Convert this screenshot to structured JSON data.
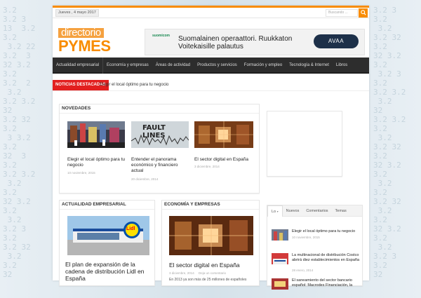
{
  "background": {
    "left_digits": "3.2\n3.2 3\n13  3.2\n3.2\n 3.2 22\n3.2  3\n32 3.2\n3.2\n3.2  2\n 3.2\n3.2 3.2\n32\n3.2 32\n3.2\n 3 3.2\n3.2\n32  3\n3.2\n3.2 3.2\n 3.2\n3.2\n32 3.2\n3.2\n 3.2\n3.2 3\n3.2\n3.2 32\n 3.2\n3.2\n32",
    "right_digits": "3.2 3\n3.2\n 3.2\n3.2 32\n3.2\n32 3.2\n3.2\n 3.2 3\n3.2\n3.2 3.2\n 3.2\n32\n3.2 3.2\n3.2\n 3.2\n3.2 32\n3.2\n32 3.2\n3.2\n 3.2\n3.2\n3.2 32\n 3.2\n3.2\n32 3.2\n3.2\n 3.2\n3.2 3\n3.2\n32"
  },
  "topbar": {
    "date": "Jueves , 4 mayo 2017",
    "search_placeholder": "Buscando ..."
  },
  "logo": {
    "line1": "directorio",
    "line2": "PYMES"
  },
  "ad": {
    "brand": "suomicom",
    "text": "Suomalainen operaattori. Ruukkaton Voitekaisille palautus",
    "button": "AVAA"
  },
  "nav": {
    "items": [
      "Actualidad empresarial",
      "Economía y empresas",
      "Áreas de actividad",
      "Productos y servicios",
      "Formación y empleo",
      "Tecnología & Internet",
      "Libros"
    ]
  },
  "ticker": {
    "label": "NOTICIAS DESTACADAS",
    "text": "Elegir el local óptimo para tu negocio"
  },
  "novedades": {
    "title": "NOVEDADES",
    "posts": [
      {
        "title": "Elegir el local óptimo para tu negocio",
        "date": "10 noviembre, 2015"
      },
      {
        "title": "Entender el panorama económico y financiero actual",
        "date": "20 diciembre, 2014",
        "thumb_text": "FAULT\nLINES"
      },
      {
        "title": "El sector digital en España",
        "date": "3 diciembre, 2014"
      }
    ]
  },
  "actualidad": {
    "title": "ACTUALIDAD EMPRESARIAL",
    "post_title": "El plan de expansión de la cadena de distribución Lidl en España",
    "thumb_sign": "Lidl"
  },
  "economia": {
    "title": "ECONOMÍA Y EMPRESAS",
    "post_title": "El sector digital en España",
    "post_date": "3 diciembre, 2014",
    "post_comments": "Deja un comentario",
    "excerpt": "En 2013 ya son más de 25 millones de españoles"
  },
  "sidebar": {
    "tabs": [
      "Lo",
      "Nuevos",
      "Comentarios",
      "Temas"
    ],
    "items": [
      {
        "title": "Elegir el local óptimo para tu negocio",
        "date": "10 noviembre, 2015"
      },
      {
        "title": "La multinacional de distribución Costco abrirá diez establecimientos en España",
        "date": "28 enero, 2014"
      },
      {
        "title": "El saneamiento del sector bancario español: Macrodes Financiación, la",
        "date": ""
      }
    ]
  },
  "colors": {
    "accent": "#f88c00",
    "nav_bg": "#2d2d2d",
    "ticker_label": "#e21f1f"
  }
}
